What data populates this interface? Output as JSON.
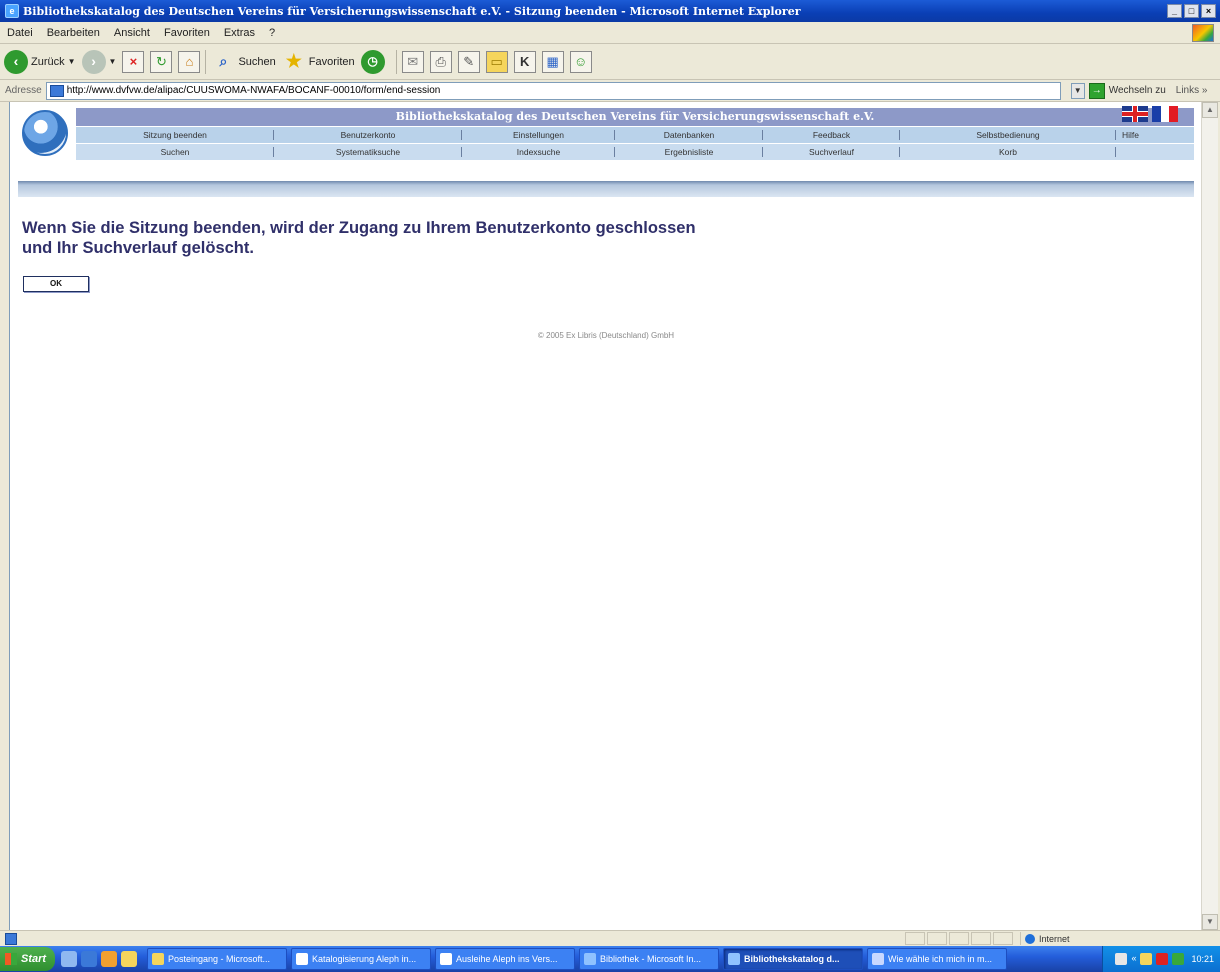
{
  "window": {
    "title": "Bibliothekskatalog des Deutschen Vereins für Versicherungswissenschaft e.V. - Sitzung beenden - Microsoft Internet Explorer",
    "btn_min": "_",
    "btn_max": "□",
    "btn_close": "×"
  },
  "menubar": {
    "items": [
      "Datei",
      "Bearbeiten",
      "Ansicht",
      "Favoriten",
      "Extras",
      "?"
    ]
  },
  "toolbar": {
    "back_label": "Zurück",
    "search_label": "Suchen",
    "favorites_label": "Favoriten"
  },
  "addressbar": {
    "label": "Adresse",
    "url": "http://www.dvfvw.de/alipac/CUUSWOMA-NWAFA/BOCANF-00010/form/end-session",
    "go_label": "Wechseln zu",
    "links_label": "Links »"
  },
  "catalog": {
    "title": "Bibliothekskatalog des Deutschen Vereins für Versicherungswissenschaft e.V.",
    "nav_row1": [
      "Sitzung beenden",
      "Benutzerkonto",
      "Einstellungen",
      "Datenbanken",
      "Feedback",
      "Selbstbedienung",
      "Hilfe"
    ],
    "nav_row2": [
      "Suchen",
      "Systematiksuche",
      "Indexsuche",
      "Ergebnisliste",
      "Suchverlauf",
      "Korb",
      ""
    ],
    "flag_colors": {
      "fr_blue": "#1a3ea8",
      "fr_white": "#ffffff",
      "fr_red": "#e21b23"
    }
  },
  "main": {
    "message": "Wenn Sie die Sitzung beenden, wird der Zugang zu Ihrem Benutzerkonto geschlossen und Ihr Suchverlauf gelöscht.",
    "ok_label": "OK",
    "copyright": "© 2005 Ex Libris (Deutschland) GmbH"
  },
  "statusbar": {
    "zone": "Internet"
  },
  "taskbar": {
    "start_label": "Start",
    "tasks": [
      "Posteingang - Microsoft...",
      "Katalogisierung Aleph in...",
      "Ausleihe Aleph ins Vers...",
      "Bibliothek - Microsoft In...",
      "Bibliothekskatalog d...",
      "Wie wähle ich mich in m..."
    ],
    "clock": "10:21"
  },
  "colors": {
    "header_title_bg": "#8d99c8",
    "nav_bg": "#b9d2ea",
    "message_text": "#30306a",
    "taskbar_blue": "#245edb"
  }
}
